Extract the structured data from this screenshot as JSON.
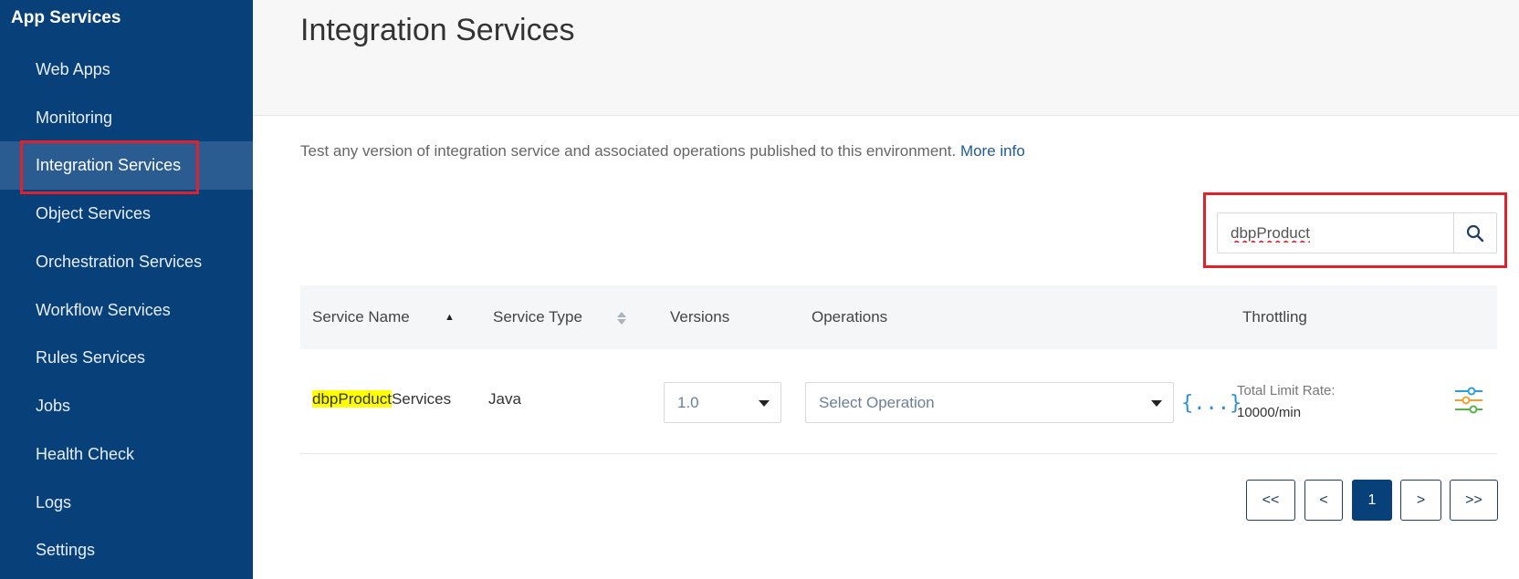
{
  "sidebar": {
    "title": "App Services",
    "items": [
      {
        "label": "Web Apps"
      },
      {
        "label": "Monitoring"
      },
      {
        "label": "Integration Services"
      },
      {
        "label": "Object Services"
      },
      {
        "label": "Orchestration Services"
      },
      {
        "label": "Workflow Services"
      },
      {
        "label": "Rules Services"
      },
      {
        "label": "Jobs"
      },
      {
        "label": "Health Check"
      },
      {
        "label": "Logs"
      },
      {
        "label": "Settings"
      }
    ]
  },
  "page": {
    "title": "Integration Services",
    "description": "Test any version of integration service and associated operations published to this environment.",
    "more_info": "More info"
  },
  "search": {
    "value": "dbpProduct",
    "icon": "search-icon"
  },
  "table": {
    "headers": {
      "service_name": "Service Name",
      "service_type": "Service Type",
      "versions": "Versions",
      "operations": "Operations",
      "throttling": "Throttling"
    },
    "rows": [
      {
        "name_match": "dbpProduct",
        "name_rest": "Services",
        "type": "Java",
        "version": "1.0",
        "operation_placeholder": "Select Operation",
        "test_icon": "{...}",
        "throttle_label": "Total Limit Rate:",
        "throttle_value": "10000/min",
        "settings_icon": "sliders-icon"
      }
    ]
  },
  "pagination": {
    "first": "<<",
    "prev": "<",
    "current": "1",
    "next": ">",
    "last": ">>"
  },
  "colors": {
    "sidebar_bg": "#084079",
    "active_item_bg": "#2a5c91",
    "highlight_border": "#e0202a",
    "link": "#1f5b96",
    "search_match": "#ffff00"
  }
}
